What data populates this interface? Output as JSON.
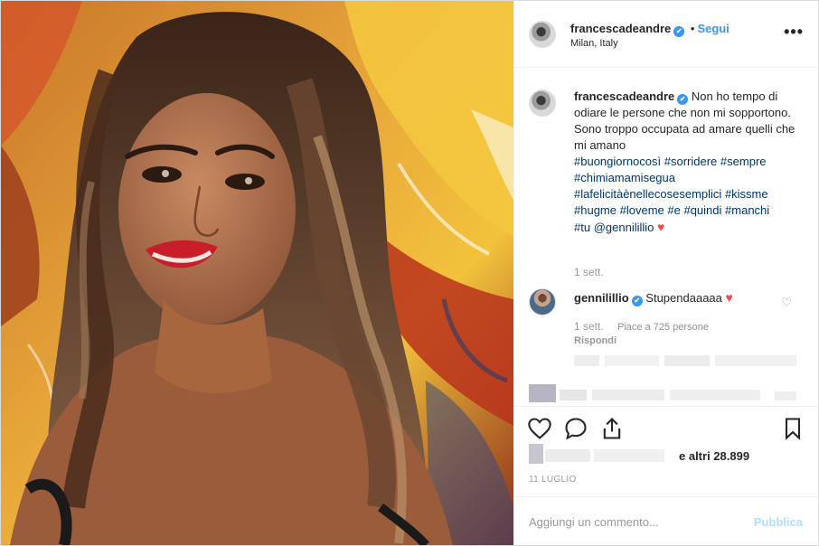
{
  "post": {
    "author": "francescadeandre",
    "verified_mark": "✔",
    "follow_separator": "•",
    "follow_label": "Segui",
    "location": "Milan, Italy",
    "more_icon": "more-options-icon"
  },
  "caption": {
    "username": "francescadeandre",
    "text_1": "Non ho tempo di odiare le persone che non mi sopportono.",
    "text_2": "Sono troppo occupata ad amare quelli che mi amano",
    "hashtags": [
      "#buongiornocosì",
      "#sorridere",
      "#sempre",
      "#chimiamamisegua",
      "#lafelicitàènellecosesemplici",
      "#kissme",
      "#hugme",
      "#loveme",
      "#e",
      "#quindi",
      "#manchi",
      "#tu"
    ],
    "mention": "@gennilillio",
    "heart": "♥",
    "time": "1 sett."
  },
  "comment": {
    "username": "gennilillio",
    "text": "Stupendaaaaa",
    "heart": "♥",
    "time": "1 sett.",
    "likes": "Piace a 725 persone",
    "reply_label": "Rispondi",
    "like_heart": "♡"
  },
  "footer": {
    "likes_suffix": "e altri 28.899",
    "date": "11 LUGLIO",
    "comment_placeholder": "Aggiungi un commento...",
    "publish_label": "Pubblica"
  },
  "colors": {
    "link_blue": "#3897f0",
    "hashtag": "#003569",
    "heart_red": "#ed4956",
    "muted": "#999999"
  }
}
